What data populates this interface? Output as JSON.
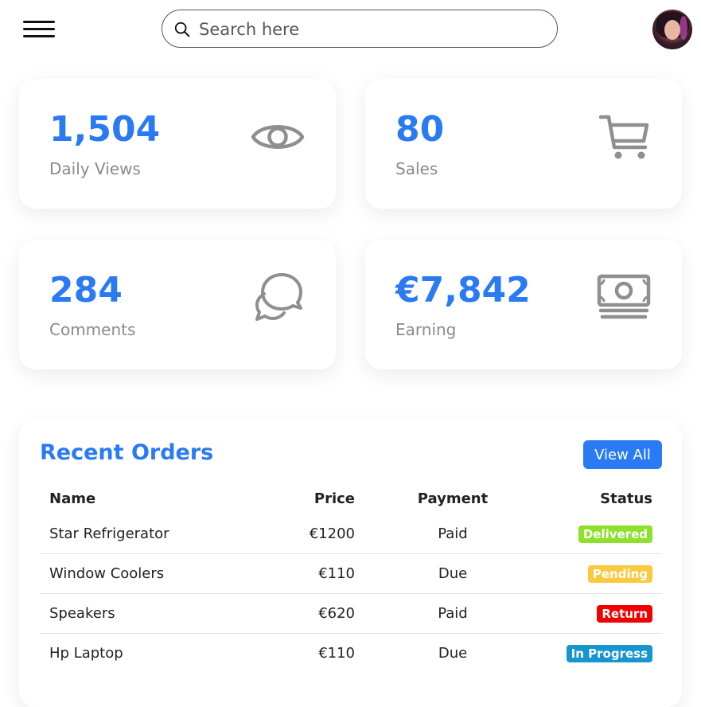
{
  "header": {
    "menu_icon": "hamburger-menu-icon",
    "search": {
      "placeholder": "Search here",
      "value": "",
      "icon": "search-icon"
    },
    "avatar_icon": "user-avatar"
  },
  "cards": [
    {
      "value": "1,504",
      "label": "Daily Views",
      "icon": "eye-icon"
    },
    {
      "value": "80",
      "label": "Sales",
      "icon": "cart-icon"
    },
    {
      "value": "284",
      "label": "Comments",
      "icon": "chat-bubbles-icon"
    },
    {
      "value": "€7,842",
      "label": "Earning",
      "icon": "cash-icon"
    }
  ],
  "recent_orders": {
    "title": "Recent Orders",
    "view_all_label": "View All",
    "columns": {
      "name": "Name",
      "price": "Price",
      "payment": "Payment",
      "status": "Status"
    },
    "rows": [
      {
        "name": "Star Refrigerator",
        "price": "€1200",
        "payment": "Paid",
        "status": "Delivered"
      },
      {
        "name": "Window Coolers",
        "price": "€110",
        "payment": "Due",
        "status": "Pending"
      },
      {
        "name": "Speakers",
        "price": "€620",
        "payment": "Paid",
        "status": "Return"
      },
      {
        "name": "Hp Laptop",
        "price": "€110",
        "payment": "Due",
        "status": "In Progress"
      }
    ]
  },
  "colors": {
    "accent": "#2a7af3",
    "muted_text": "#8a8a8a",
    "icon_gray": "#8f8f8f",
    "status_delivered": "#8de02c",
    "status_pending": "#f9ca3f",
    "status_return": "#f00000",
    "status_in_progress": "#1795ce"
  }
}
